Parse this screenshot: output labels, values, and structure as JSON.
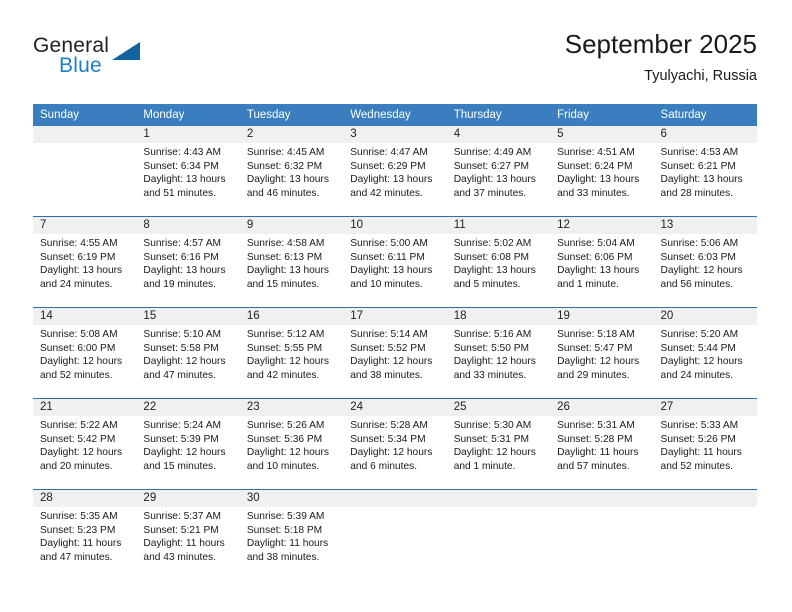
{
  "brand": {
    "name_part1": "General",
    "name_part2": "Blue",
    "triangle_color": "#11659f",
    "blue_text_color": "#1f7fc4"
  },
  "header": {
    "title": "September 2025",
    "subtitle": "Tyulyachi, Russia"
  },
  "theme": {
    "header_row_bg": "#3a7ebf",
    "row_divider": "#2f6fb0",
    "daynum_band_bg": "#f0f0f0"
  },
  "weekday_headers": [
    "Sunday",
    "Monday",
    "Tuesday",
    "Wednesday",
    "Thursday",
    "Friday",
    "Saturday"
  ],
  "weeks": [
    [
      {
        "day": "",
        "sunrise": "",
        "sunset": "",
        "daylight1": "",
        "daylight2": ""
      },
      {
        "day": "1",
        "sunrise": "Sunrise: 4:43 AM",
        "sunset": "Sunset: 6:34 PM",
        "daylight1": "Daylight: 13 hours",
        "daylight2": "and 51 minutes."
      },
      {
        "day": "2",
        "sunrise": "Sunrise: 4:45 AM",
        "sunset": "Sunset: 6:32 PM",
        "daylight1": "Daylight: 13 hours",
        "daylight2": "and 46 minutes."
      },
      {
        "day": "3",
        "sunrise": "Sunrise: 4:47 AM",
        "sunset": "Sunset: 6:29 PM",
        "daylight1": "Daylight: 13 hours",
        "daylight2": "and 42 minutes."
      },
      {
        "day": "4",
        "sunrise": "Sunrise: 4:49 AM",
        "sunset": "Sunset: 6:27 PM",
        "daylight1": "Daylight: 13 hours",
        "daylight2": "and 37 minutes."
      },
      {
        "day": "5",
        "sunrise": "Sunrise: 4:51 AM",
        "sunset": "Sunset: 6:24 PM",
        "daylight1": "Daylight: 13 hours",
        "daylight2": "and 33 minutes."
      },
      {
        "day": "6",
        "sunrise": "Sunrise: 4:53 AM",
        "sunset": "Sunset: 6:21 PM",
        "daylight1": "Daylight: 13 hours",
        "daylight2": "and 28 minutes."
      }
    ],
    [
      {
        "day": "7",
        "sunrise": "Sunrise: 4:55 AM",
        "sunset": "Sunset: 6:19 PM",
        "daylight1": "Daylight: 13 hours",
        "daylight2": "and 24 minutes."
      },
      {
        "day": "8",
        "sunrise": "Sunrise: 4:57 AM",
        "sunset": "Sunset: 6:16 PM",
        "daylight1": "Daylight: 13 hours",
        "daylight2": "and 19 minutes."
      },
      {
        "day": "9",
        "sunrise": "Sunrise: 4:58 AM",
        "sunset": "Sunset: 6:13 PM",
        "daylight1": "Daylight: 13 hours",
        "daylight2": "and 15 minutes."
      },
      {
        "day": "10",
        "sunrise": "Sunrise: 5:00 AM",
        "sunset": "Sunset: 6:11 PM",
        "daylight1": "Daylight: 13 hours",
        "daylight2": "and 10 minutes."
      },
      {
        "day": "11",
        "sunrise": "Sunrise: 5:02 AM",
        "sunset": "Sunset: 6:08 PM",
        "daylight1": "Daylight: 13 hours",
        "daylight2": "and 5 minutes."
      },
      {
        "day": "12",
        "sunrise": "Sunrise: 5:04 AM",
        "sunset": "Sunset: 6:06 PM",
        "daylight1": "Daylight: 13 hours",
        "daylight2": "and 1 minute."
      },
      {
        "day": "13",
        "sunrise": "Sunrise: 5:06 AM",
        "sunset": "Sunset: 6:03 PM",
        "daylight1": "Daylight: 12 hours",
        "daylight2": "and 56 minutes."
      }
    ],
    [
      {
        "day": "14",
        "sunrise": "Sunrise: 5:08 AM",
        "sunset": "Sunset: 6:00 PM",
        "daylight1": "Daylight: 12 hours",
        "daylight2": "and 52 minutes."
      },
      {
        "day": "15",
        "sunrise": "Sunrise: 5:10 AM",
        "sunset": "Sunset: 5:58 PM",
        "daylight1": "Daylight: 12 hours",
        "daylight2": "and 47 minutes."
      },
      {
        "day": "16",
        "sunrise": "Sunrise: 5:12 AM",
        "sunset": "Sunset: 5:55 PM",
        "daylight1": "Daylight: 12 hours",
        "daylight2": "and 42 minutes."
      },
      {
        "day": "17",
        "sunrise": "Sunrise: 5:14 AM",
        "sunset": "Sunset: 5:52 PM",
        "daylight1": "Daylight: 12 hours",
        "daylight2": "and 38 minutes."
      },
      {
        "day": "18",
        "sunrise": "Sunrise: 5:16 AM",
        "sunset": "Sunset: 5:50 PM",
        "daylight1": "Daylight: 12 hours",
        "daylight2": "and 33 minutes."
      },
      {
        "day": "19",
        "sunrise": "Sunrise: 5:18 AM",
        "sunset": "Sunset: 5:47 PM",
        "daylight1": "Daylight: 12 hours",
        "daylight2": "and 29 minutes."
      },
      {
        "day": "20",
        "sunrise": "Sunrise: 5:20 AM",
        "sunset": "Sunset: 5:44 PM",
        "daylight1": "Daylight: 12 hours",
        "daylight2": "and 24 minutes."
      }
    ],
    [
      {
        "day": "21",
        "sunrise": "Sunrise: 5:22 AM",
        "sunset": "Sunset: 5:42 PM",
        "daylight1": "Daylight: 12 hours",
        "daylight2": "and 20 minutes."
      },
      {
        "day": "22",
        "sunrise": "Sunrise: 5:24 AM",
        "sunset": "Sunset: 5:39 PM",
        "daylight1": "Daylight: 12 hours",
        "daylight2": "and 15 minutes."
      },
      {
        "day": "23",
        "sunrise": "Sunrise: 5:26 AM",
        "sunset": "Sunset: 5:36 PM",
        "daylight1": "Daylight: 12 hours",
        "daylight2": "and 10 minutes."
      },
      {
        "day": "24",
        "sunrise": "Sunrise: 5:28 AM",
        "sunset": "Sunset: 5:34 PM",
        "daylight1": "Daylight: 12 hours",
        "daylight2": "and 6 minutes."
      },
      {
        "day": "25",
        "sunrise": "Sunrise: 5:30 AM",
        "sunset": "Sunset: 5:31 PM",
        "daylight1": "Daylight: 12 hours",
        "daylight2": "and 1 minute."
      },
      {
        "day": "26",
        "sunrise": "Sunrise: 5:31 AM",
        "sunset": "Sunset: 5:28 PM",
        "daylight1": "Daylight: 11 hours",
        "daylight2": "and 57 minutes."
      },
      {
        "day": "27",
        "sunrise": "Sunrise: 5:33 AM",
        "sunset": "Sunset: 5:26 PM",
        "daylight1": "Daylight: 11 hours",
        "daylight2": "and 52 minutes."
      }
    ],
    [
      {
        "day": "28",
        "sunrise": "Sunrise: 5:35 AM",
        "sunset": "Sunset: 5:23 PM",
        "daylight1": "Daylight: 11 hours",
        "daylight2": "and 47 minutes."
      },
      {
        "day": "29",
        "sunrise": "Sunrise: 5:37 AM",
        "sunset": "Sunset: 5:21 PM",
        "daylight1": "Daylight: 11 hours",
        "daylight2": "and 43 minutes."
      },
      {
        "day": "30",
        "sunrise": "Sunrise: 5:39 AM",
        "sunset": "Sunset: 5:18 PM",
        "daylight1": "Daylight: 11 hours",
        "daylight2": "and 38 minutes."
      },
      {
        "day": "",
        "sunrise": "",
        "sunset": "",
        "daylight1": "",
        "daylight2": ""
      },
      {
        "day": "",
        "sunrise": "",
        "sunset": "",
        "daylight1": "",
        "daylight2": ""
      },
      {
        "day": "",
        "sunrise": "",
        "sunset": "",
        "daylight1": "",
        "daylight2": ""
      },
      {
        "day": "",
        "sunrise": "",
        "sunset": "",
        "daylight1": "",
        "daylight2": ""
      }
    ]
  ]
}
